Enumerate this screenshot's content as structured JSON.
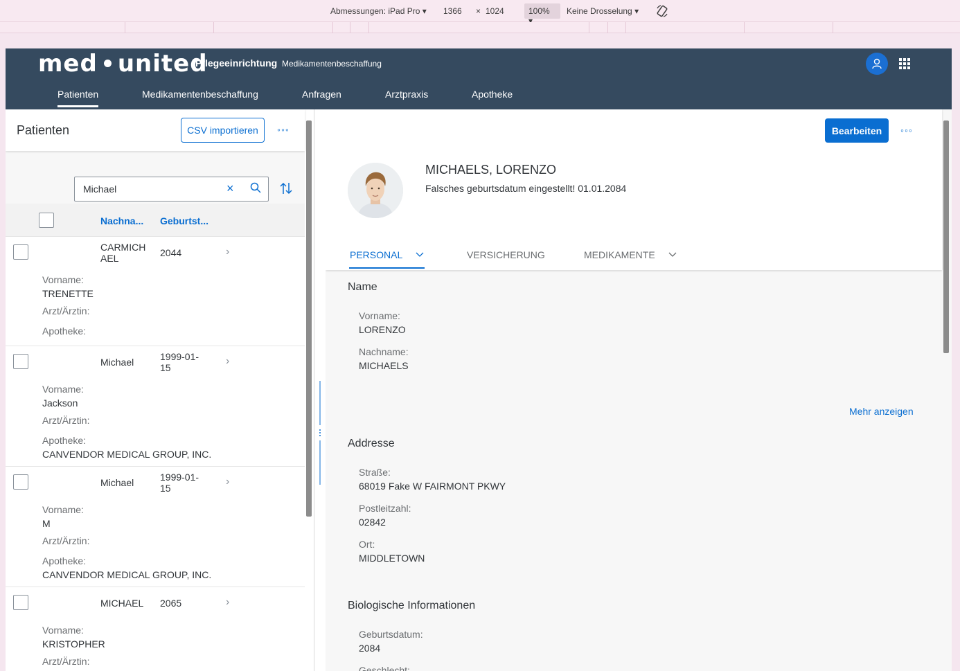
{
  "devtools": {
    "dimensions_label": "Abmessungen: iPad Pro",
    "width": "1366",
    "times": "×",
    "height": "1024",
    "zoom": "100%",
    "throttle": "Keine Drosselung",
    "rotate_icon": "rotate-icon"
  },
  "shell": {
    "logo_left": "med",
    "logo_right": "united",
    "title": "Pflegeeinrichtung",
    "subtitle": "Medikamentenbeschaffung",
    "user_icon": "user-icon",
    "apps_icon": "grid-icon"
  },
  "nav": {
    "tabs": [
      {
        "label": "Patienten",
        "active": true
      },
      {
        "label": "Medikamentenbeschaffung",
        "active": false
      },
      {
        "label": "Anfragen",
        "active": false
      },
      {
        "label": "Arztpraxis",
        "active": false
      },
      {
        "label": "Apotheke",
        "active": false
      }
    ]
  },
  "master": {
    "title": "Patienten",
    "csv_button": "CSV importieren",
    "more": "◦◦◦",
    "search": {
      "value": "Michael",
      "clear_icon": "×"
    },
    "columns": {
      "lastname": "Nachna...",
      "dob": "Geburtst..."
    },
    "labels": {
      "firstname": "Vorname:",
      "doctor": "Arzt/Ärztin:",
      "pharmacy": "Apotheke:"
    },
    "rows": [
      {
        "lastname": "CARMICH AEL",
        "dob": "2044",
        "firstname": "TRENETTE",
        "doctor": "",
        "pharmacy": ""
      },
      {
        "lastname": "Michael",
        "dob": "1999-01-15",
        "firstname": "Jackson",
        "doctor": "",
        "pharmacy": "CANVENDOR MEDICAL GROUP, INC."
      },
      {
        "lastname": "Michael",
        "dob": "1999-01-15",
        "firstname": "M",
        "doctor": "",
        "pharmacy": "CANVENDOR MEDICAL GROUP, INC."
      },
      {
        "lastname": "MICHAEL",
        "dob": "2065",
        "firstname": "KRISTOPHER",
        "doctor": "",
        "pharmacy": ""
      }
    ]
  },
  "detail": {
    "edit_button": "Bearbeiten",
    "more": "◦◦◦",
    "name": "MICHAELS, LORENZO",
    "subtitle": "Falsches geburtsdatum eingestellt! 01.01.2084",
    "tabs": [
      {
        "label": "PERSONAL",
        "active": true,
        "has_menu": true
      },
      {
        "label": "VERSICHERUNG",
        "active": false,
        "has_menu": false
      },
      {
        "label": "MEDIKAMENTE",
        "active": false,
        "has_menu": true
      }
    ],
    "sections": {
      "name": {
        "title": "Name",
        "firstname_label": "Vorname:",
        "firstname": "LORENZO",
        "lastname_label": "Nachname:",
        "lastname": "MICHAELS",
        "more_link": "Mehr anzeigen"
      },
      "address": {
        "title": "Addresse",
        "street_label": "Straße:",
        "street": "68019 Fake W FAIRMONT PKWY",
        "zip_label": "Postleitzahl:",
        "zip": "02842",
        "city_label": "Ort:",
        "city": "MIDDLETOWN"
      },
      "bio": {
        "title": "Biologische Informationen",
        "dob_label": "Geburtsdatum:",
        "dob": "2084",
        "gender_label": "Geschlecht:"
      }
    }
  }
}
